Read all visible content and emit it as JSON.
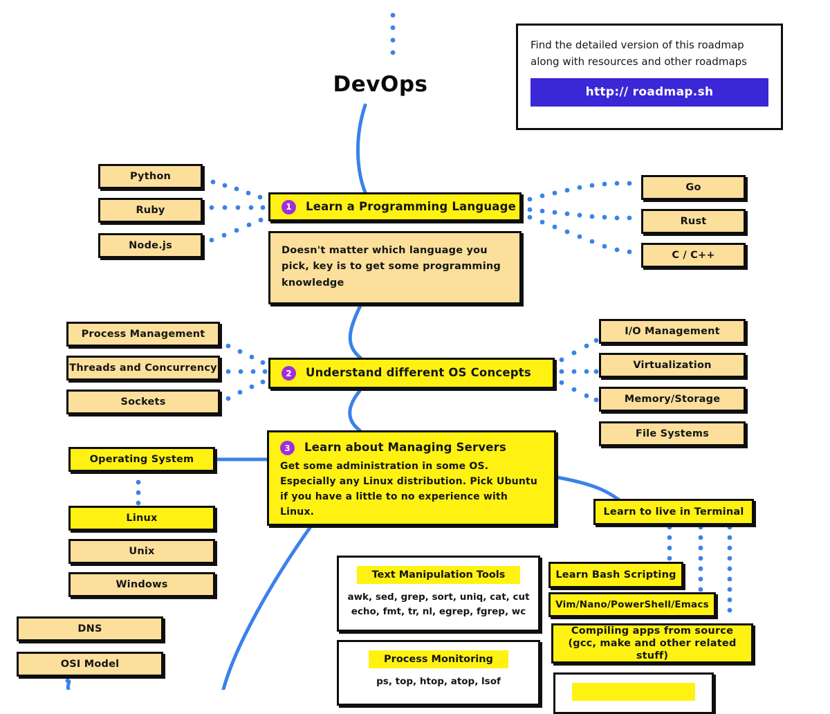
{
  "title": "DevOps",
  "info_panel": {
    "line1": "Find the detailed version of this roadmap",
    "line2": "along with resources and other roadmaps",
    "url": "http:// roadmap.sh"
  },
  "colors": {
    "tan": "#fbdf9b",
    "yellow": "#fff212",
    "badge_purple": "#a32ddb",
    "connector_blue": "#3b82e8",
    "url_button": "#3a27d6",
    "outline": "#0d0d0d"
  },
  "sections": [
    {
      "number": "1",
      "title": "Learn a Programming Language",
      "description": "Doesn't matter which language you pick, key is to get some programming knowledge",
      "left_items": [
        "Python",
        "Ruby",
        "Node.js"
      ],
      "right_items": [
        "Go",
        "Rust",
        "C / C++"
      ]
    },
    {
      "number": "2",
      "title": "Understand different OS Concepts",
      "left_items": [
        "Process Management",
        "Threads and Concurrency",
        "Sockets"
      ],
      "right_items": [
        "I/O Management",
        "Virtualization",
        "Memory/Storage",
        "File Systems"
      ]
    },
    {
      "number": "3",
      "title": "Learn about Managing Servers",
      "description": "Get some administration in some OS. Especially any Linux distribution. Pick Ubuntu if you have a little to no experience with Linux."
    }
  ],
  "os_branch": {
    "root": "Operating System",
    "items": [
      "Linux",
      "Unix",
      "Windows"
    ]
  },
  "networking_items": [
    "DNS",
    "OSI Model"
  ],
  "terminal_branch": {
    "root": "Learn to live in Terminal",
    "items": [
      "Learn Bash Scripting",
      "Vim/Nano/PowerShell/Emacs",
      "Compiling apps from source\n(gcc, make and other related stuff)"
    ]
  },
  "tool_cards": [
    {
      "title": "Text Manipulation Tools",
      "lines": [
        "awk, sed, grep, sort, uniq, cat, cut",
        "echo, fmt, tr, nl, egrep, fgrep, wc"
      ]
    },
    {
      "title": "Process Monitoring",
      "lines": [
        "ps, top, htop, atop, lsof"
      ]
    }
  ]
}
